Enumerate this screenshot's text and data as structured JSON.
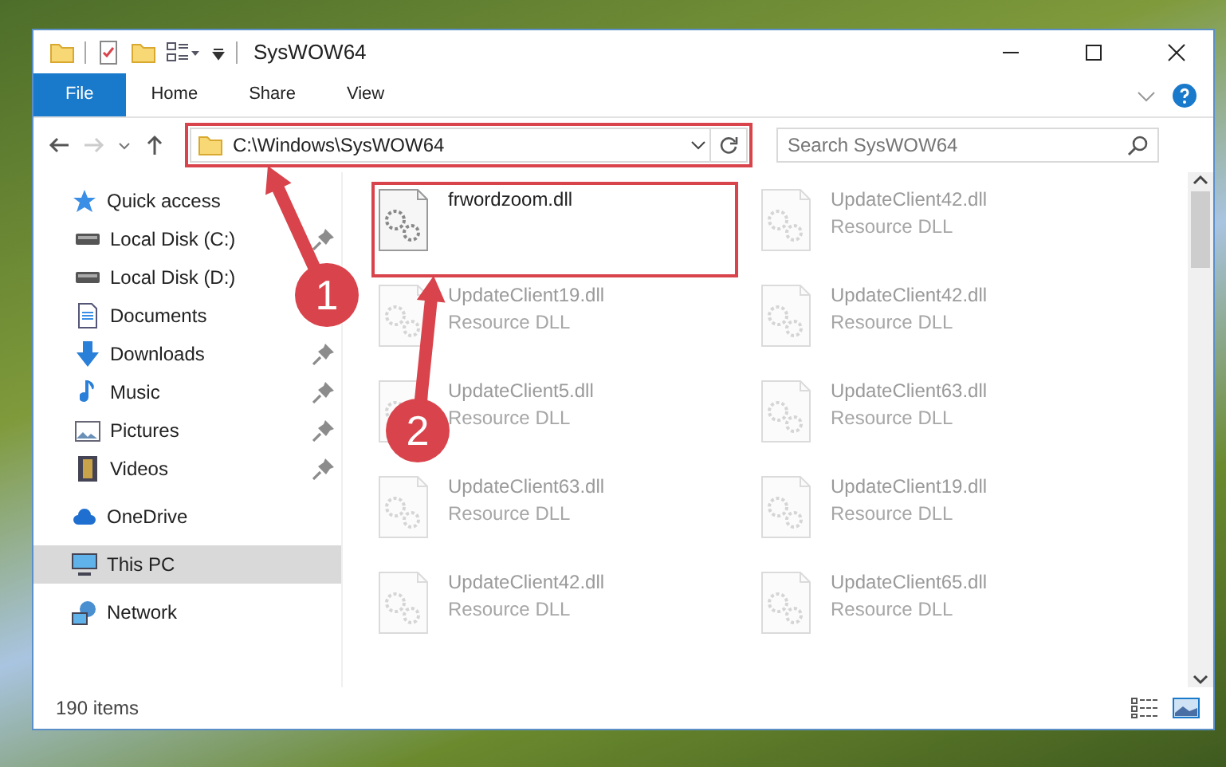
{
  "window": {
    "title": "SysWOW64"
  },
  "ribbon_tabs": [
    {
      "label": "File",
      "kind": "file"
    },
    {
      "label": "Home",
      "kind": "tab"
    },
    {
      "label": "Share",
      "kind": "tab"
    },
    {
      "label": "View",
      "kind": "tab"
    }
  ],
  "address_bar": {
    "path": "C:\\Windows\\SysWOW64",
    "highlighted": true
  },
  "search": {
    "placeholder": "Search SysWOW64"
  },
  "sidebar": {
    "items": [
      {
        "label": "Quick access",
        "kind": "star",
        "selected": false,
        "children": [
          {
            "label": "Local Disk (C:)",
            "kind": "disk",
            "pinned": true,
            "selected": false
          },
          {
            "label": "Local Disk (D:)",
            "kind": "disk",
            "pinned": false,
            "selected": false
          },
          {
            "label": "Documents",
            "kind": "document",
            "pinned": false,
            "selected": false
          },
          {
            "label": "Downloads",
            "kind": "download",
            "pinned": true,
            "selected": false
          },
          {
            "label": "Music",
            "kind": "music",
            "pinned": true,
            "selected": false
          },
          {
            "label": "Pictures",
            "kind": "picture",
            "pinned": true,
            "selected": false
          },
          {
            "label": "Videos",
            "kind": "video",
            "pinned": true,
            "selected": false
          }
        ]
      },
      {
        "label": "OneDrive",
        "kind": "cloud",
        "selected": false
      },
      {
        "label": "This PC",
        "kind": "pc",
        "selected": true
      },
      {
        "label": "Network",
        "kind": "network",
        "selected": false
      }
    ]
  },
  "files": [
    {
      "name": "frwordzoom.dll",
      "faded": false,
      "highlighted": true
    },
    {
      "name": "UpdateClient42.dll",
      "type": "Resource DLL",
      "faded": true,
      "highlighted": false
    },
    {
      "name": "UpdateClient19.dll",
      "type": "Resource DLL",
      "faded": true,
      "highlighted": false
    },
    {
      "name": "UpdateClient42.dll",
      "type": "Resource DLL",
      "faded": true,
      "highlighted": false
    },
    {
      "name": "UpdateClient5.dll",
      "type": "Resource DLL",
      "faded": true,
      "highlighted": false
    },
    {
      "name": "UpdateClient63.dll",
      "type": "Resource DLL",
      "faded": true,
      "highlighted": false
    },
    {
      "name": "UpdateClient63.dll",
      "type": "Resource DLL",
      "faded": true,
      "highlighted": false
    },
    {
      "name": "UpdateClient19.dll",
      "type": "Resource DLL",
      "faded": true,
      "highlighted": false
    },
    {
      "name": "UpdateClient42.dll",
      "type": "Resource DLL",
      "faded": true,
      "highlighted": false
    },
    {
      "name": "UpdateClient65.dll",
      "type": "Resource DLL",
      "faded": true,
      "highlighted": false
    }
  ],
  "status_bar": {
    "item_count": "190 items"
  },
  "annotations": [
    {
      "label": "1"
    },
    {
      "label": "2"
    }
  ]
}
